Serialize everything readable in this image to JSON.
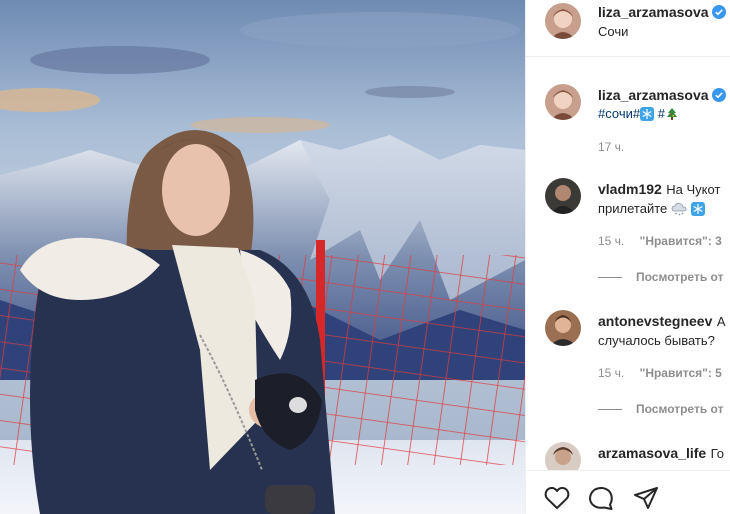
{
  "header": {
    "username": "liza_arzamasova",
    "location": "Сочи"
  },
  "caption": {
    "username": "liza_arzamasova",
    "tag1": "#сочи",
    "tag2": "#",
    "tag3": "#",
    "time": "17 ч."
  },
  "comments": [
    {
      "username": "vladm192",
      "text_line1": "На Чукот",
      "text_line2": "прилетайте",
      "time": "15 ч.",
      "likes": "\"Нравится\": 3",
      "view_replies": "Посмотреть от"
    },
    {
      "username": "antonevstegneev",
      "text_line1": "А",
      "text_line2": "случалось бывать?",
      "time": "15 ч.",
      "likes": "\"Нравится\": 5",
      "view_replies": "Посмотреть от"
    },
    {
      "username": "arzamasova_life",
      "text_line1": "Го"
    }
  ],
  "icons": {
    "verified": "verified-badge-icon",
    "like": "heart-icon",
    "comment": "comment-icon",
    "share": "paper-plane-icon",
    "snowflake": "snowflake-emoji-icon",
    "tree": "christmas-tree-emoji-icon",
    "cloud": "cloud-snow-emoji-icon"
  },
  "colors": {
    "verified": "#3897f0",
    "hashtag": "#00376b",
    "meta": "#8e8e8e"
  }
}
